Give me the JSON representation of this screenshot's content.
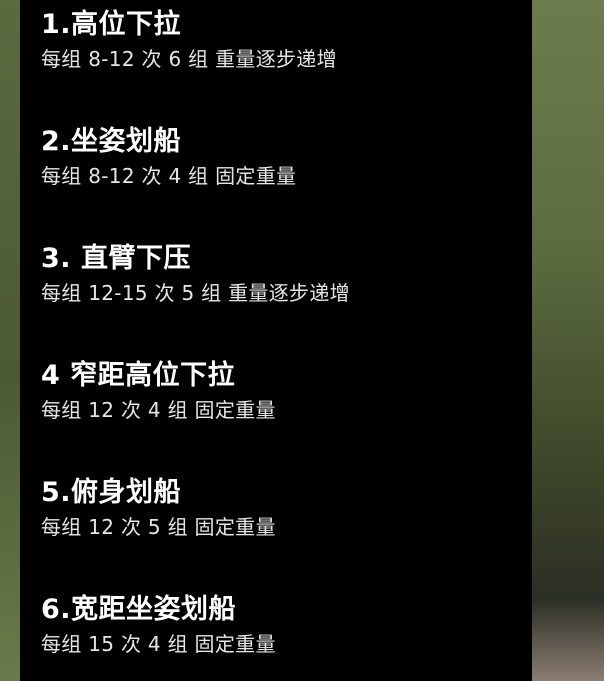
{
  "workout": {
    "items": [
      {
        "title": "1.高位下拉",
        "detail": "每组 8-12 次 6 组 重量逐步递增"
      },
      {
        "title": "2.坐姿划船",
        "detail": "每组 8-12 次 4 组 固定重量"
      },
      {
        "title": "3. 直臂下压",
        "detail": "每组 12-15 次 5 组 重量逐步递增"
      },
      {
        "title": "4 窄距高位下拉",
        "detail": "每组 12 次 4 组 固定重量"
      },
      {
        "title": "5.俯身划船",
        "detail": "每组 12 次 5 组 固定重量"
      },
      {
        "title": "6.宽距坐姿划船",
        "detail": "每组 15 次 4 组 固定重量"
      }
    ]
  }
}
